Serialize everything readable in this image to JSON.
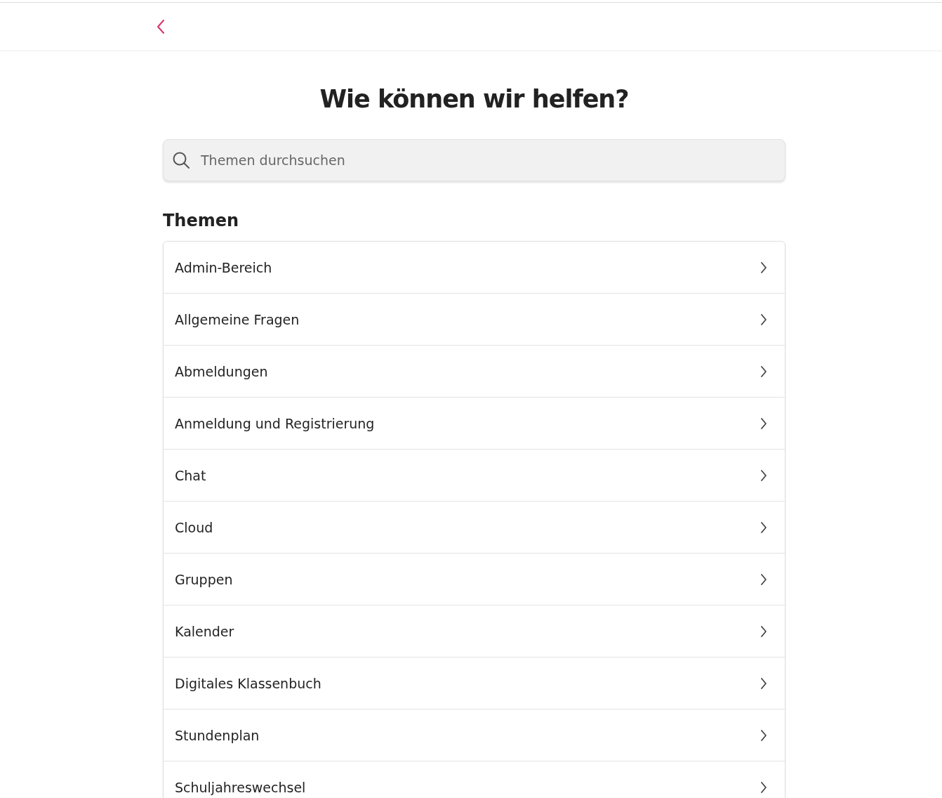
{
  "title": "Wie können wir helfen?",
  "search": {
    "placeholder": "Themen durchsuchen"
  },
  "section_title": "Themen",
  "topics": [
    {
      "label": "Admin-Bereich"
    },
    {
      "label": "Allgemeine Fragen"
    },
    {
      "label": "Abmeldungen"
    },
    {
      "label": "Anmeldung und Registrierung"
    },
    {
      "label": "Chat"
    },
    {
      "label": "Cloud"
    },
    {
      "label": "Gruppen"
    },
    {
      "label": "Kalender"
    },
    {
      "label": "Digitales Klassenbuch"
    },
    {
      "label": "Stundenplan"
    },
    {
      "label": "Schuljahreswechsel"
    }
  ]
}
